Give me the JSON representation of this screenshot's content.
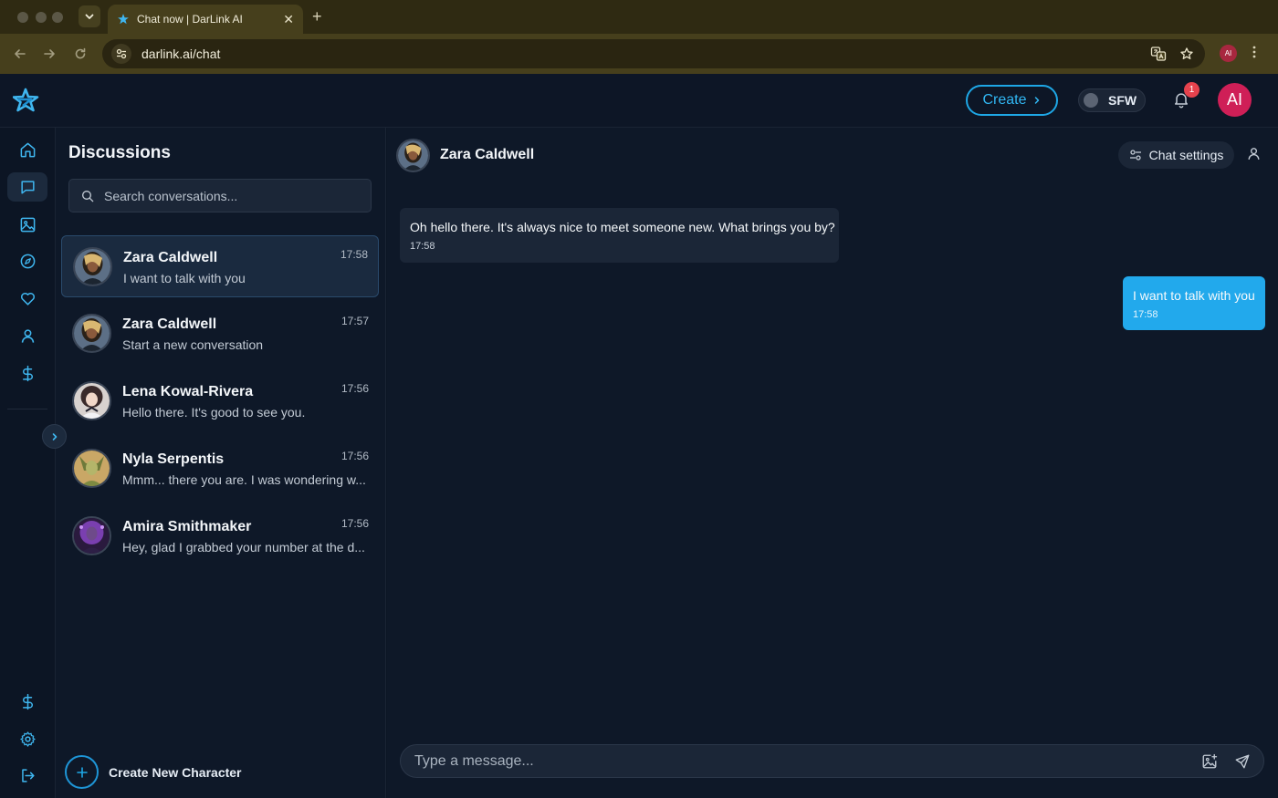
{
  "browser": {
    "tab_title": "Chat now | DarLink AI",
    "url": "darlink.ai/chat",
    "profile_initials": "AI"
  },
  "header": {
    "create_label": "Create",
    "sfw_label": "SFW",
    "notification_count": "1",
    "user_initials": "AI",
    "accent_color": "#1ea7e6"
  },
  "sidebar": {
    "title": "Discussions",
    "search_placeholder": "Search conversations...",
    "conversations": [
      {
        "name": "Zara Caldwell",
        "preview": "I want to talk with you",
        "time": "17:58",
        "active": true
      },
      {
        "name": "Zara Caldwell",
        "preview": "Start a new conversation",
        "time": "17:57",
        "active": false
      },
      {
        "name": "Lena Kowal-Rivera",
        "preview": "Hello there. It's good to see you.",
        "time": "17:56",
        "active": false
      },
      {
        "name": "Nyla Serpentis",
        "preview": "Mmm... there you are. I was wondering w...",
        "time": "17:56",
        "active": false
      },
      {
        "name": "Amira Smithmaker",
        "preview": "Hey, glad I grabbed your number at the d...",
        "time": "17:56",
        "active": false
      }
    ],
    "create_character_label": "Create New Character"
  },
  "chat": {
    "character_name": "Zara Caldwell",
    "settings_label": "Chat settings",
    "messages": [
      {
        "from": "character",
        "text": "Oh hello there. It's always nice to meet someone new. What brings you by?",
        "time": "17:58"
      },
      {
        "from": "user",
        "text": "I want to talk with you",
        "time": "17:58"
      }
    ],
    "input_placeholder": "Type a message..."
  }
}
